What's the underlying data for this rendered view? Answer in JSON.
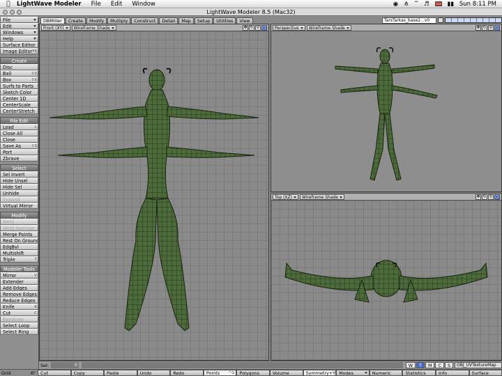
{
  "menubar": {
    "apple_icon": "apple-icon",
    "app_name": "LightWave Modeler",
    "menus": [
      "File",
      "Edit",
      "Window"
    ],
    "clock": "Sun 8:11 PM"
  },
  "window": {
    "title": "LightWave Modeler 8.5 (Mac32)"
  },
  "toolbar": {
    "top_menus": [
      "File",
      "Edit",
      "Windows",
      "Help"
    ],
    "editors": [
      {
        "label": "Surface Editor",
        "key": ""
      },
      {
        "label": "Image Editor",
        "key": "F6"
      }
    ],
    "sections": [
      {
        "title": "Create",
        "items": [
          {
            "label": "Disc",
            "key": ""
          },
          {
            "label": "Ball",
            "key": "⇧0"
          },
          {
            "label": "Box",
            "key": "⇧X"
          },
          {
            "label": "Surfs to Parts",
            "key": ""
          },
          {
            "label": "Sketch Color",
            "key": ""
          },
          {
            "label": "Center 1D",
            "key": ""
          },
          {
            "label": "CenterScale",
            "key": ""
          },
          {
            "label": "CenterStretch",
            "key": ""
          }
        ]
      },
      {
        "title": "File Edit",
        "items": [
          {
            "label": "Load",
            "key": "L"
          },
          {
            "label": "Close All",
            "key": ""
          },
          {
            "label": "Close",
            "key": ""
          },
          {
            "label": "Save As",
            "key": "⇧S"
          },
          {
            "label": "Port",
            "key": ""
          },
          {
            "label": "Zbrave",
            "key": ""
          }
        ]
      },
      {
        "title": "Select",
        "items": [
          {
            "label": "Sel Invert",
            "key": ""
          },
          {
            "label": "Hide Unsel",
            "key": ""
          },
          {
            "label": "Hide Sel",
            "key": ""
          },
          {
            "label": "Unhide",
            "key": ""
          },
          {
            "label": "Expand",
            "key": "",
            "disabled": true
          },
          {
            "label": "Virtual Mirror",
            "key": ""
          }
        ]
      },
      {
        "title": "Modify",
        "items": [
          {
            "label": "Weld",
            "key": "",
            "disabled": true
          },
          {
            "label": "Weld Average",
            "key": "",
            "disabled": true
          },
          {
            "label": "Merge Points",
            "key": ""
          },
          {
            "label": "Rest On Ground",
            "key": ""
          },
          {
            "label": "EdgBvl",
            "key": ""
          },
          {
            "label": "Multishift",
            "key": ""
          },
          {
            "label": "Triple",
            "key": "T"
          }
        ]
      },
      {
        "title": "Modeler Tools",
        "items": [
          {
            "label": "Mirror",
            "key": "V"
          },
          {
            "label": "Extender",
            "key": ""
          },
          {
            "label": "Add Edges",
            "key": ""
          },
          {
            "label": "Remove Edges",
            "key": ""
          },
          {
            "label": "Reduce Edges",
            "key": ""
          },
          {
            "label": "Knife",
            "key": "K"
          },
          {
            "label": "Cut",
            "key": "C"
          },
          {
            "label": "Bandsaw",
            "key": "",
            "disabled": true
          },
          {
            "label": "Select Loop",
            "key": ""
          },
          {
            "label": "Select Ring",
            "key": ""
          }
        ]
      }
    ]
  },
  "tabs": [
    "DBMiller",
    "Create",
    "Modify",
    "Multiply",
    "Construct",
    "Detail",
    "Map",
    "Setup",
    "Utilities",
    "View"
  ],
  "active_tab": "DBMiller",
  "layer_select": "TarsTarkas_base2...v0",
  "viewports": {
    "front": {
      "view": "Front",
      "axes": "(XY)",
      "shading": "Wireframe Shade"
    },
    "perspective": {
      "view": "Perspective",
      "shading": "Wireframe Shade"
    },
    "top": {
      "view": "Top",
      "axes": "(XZ)",
      "shading": "Wireframe Shade"
    }
  },
  "infobar": {
    "sel_label": "Sel:",
    "sel_value": "0",
    "modes": [
      "W",
      "T",
      "M",
      "C",
      "S"
    ],
    "active_mode": "T",
    "uv_map": "OBJ_UVTextureMap"
  },
  "bottombar": {
    "grid_label": "Grid",
    "grid_value": "6\"",
    "buttons": [
      {
        "label": "Cut",
        "key": ""
      },
      {
        "label": "Copy",
        "key": ""
      },
      {
        "label": "Paste",
        "key": ""
      },
      {
        "label": "Undo",
        "key": ""
      },
      {
        "label": "Redo",
        "key": ""
      },
      {
        "label": "Points",
        "key": "^G",
        "on": true
      },
      {
        "label": "Polygons",
        "key": ""
      },
      {
        "label": "Volume",
        "key": ""
      },
      {
        "label": "Symmetry+Y",
        "key": "",
        "on": true
      },
      {
        "label": "Modes",
        "key": "",
        "dd": true
      },
      {
        "label": "Numeric",
        "key": ""
      },
      {
        "label": "Statistics",
        "key": ""
      },
      {
        "label": "Info",
        "key": ""
      },
      {
        "label": "Surface",
        "key": ""
      }
    ]
  },
  "colors": {
    "model_fill": "#4d6a3a",
    "model_stroke": "#17230f",
    "grid": "#7b7b7b",
    "viewport_bg": "#8a8a8a",
    "highlight": "#4c6bc4"
  }
}
